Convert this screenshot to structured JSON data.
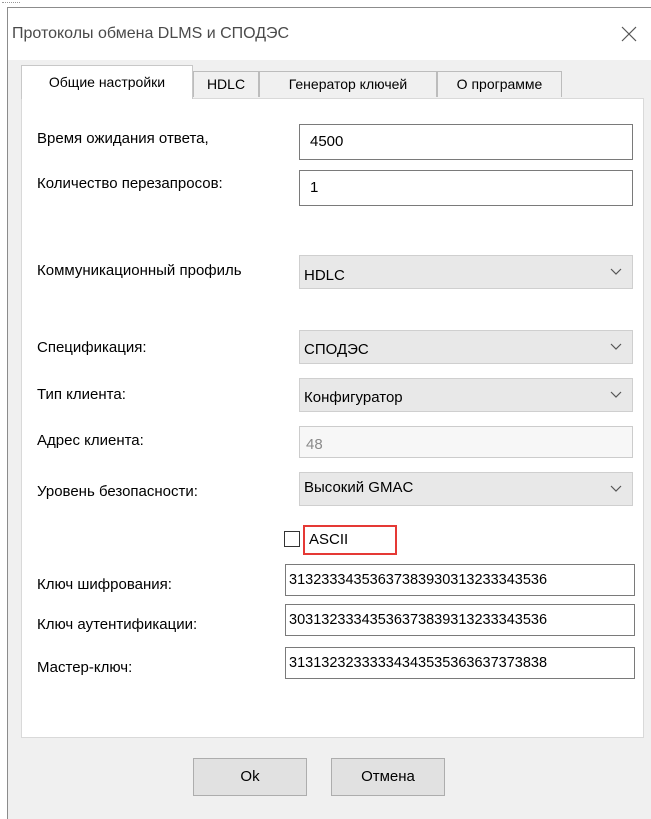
{
  "window": {
    "title": "Протоколы обмена DLMS и СПОДЭС"
  },
  "tabs": [
    {
      "label": "Общие настройки",
      "active": true
    },
    {
      "label": "HDLC",
      "active": false
    },
    {
      "label": "Генератор ключей",
      "active": false
    },
    {
      "label": "О программе",
      "active": false
    }
  ],
  "fields": {
    "response_timeout": {
      "label": "Время ожидания ответа,",
      "value": "4500"
    },
    "retries": {
      "label": "Количество перезапросов:",
      "value": "1"
    },
    "comm_profile": {
      "label": "Коммуникационный профиль",
      "value": "HDLC"
    },
    "specification": {
      "label": "Спецификация:",
      "value": "СПОДЭС"
    },
    "client_type": {
      "label": "Тип клиента:",
      "value": "Конфигуратор"
    },
    "client_address": {
      "label": "Адрес клиента:",
      "value": "48"
    },
    "security_level": {
      "label": "Уровень безопасности:",
      "value": "Высокий GMAC"
    },
    "ascii": {
      "label": "ASCII",
      "checked": false
    },
    "encryption_key": {
      "label": "Ключ шифрования:",
      "value": "31323334353637383930313233343536"
    },
    "auth_key": {
      "label": "Ключ аутентификации:",
      "value": "30313233343536373839313233343536"
    },
    "master_key": {
      "label": "Мастер-ключ:",
      "value": "31313232333334343535363637373838"
    }
  },
  "buttons": {
    "ok": "Ok",
    "cancel": "Отмена"
  },
  "colors": {
    "highlight": "#e53935",
    "dialog_bg": "#f0f0f0"
  }
}
